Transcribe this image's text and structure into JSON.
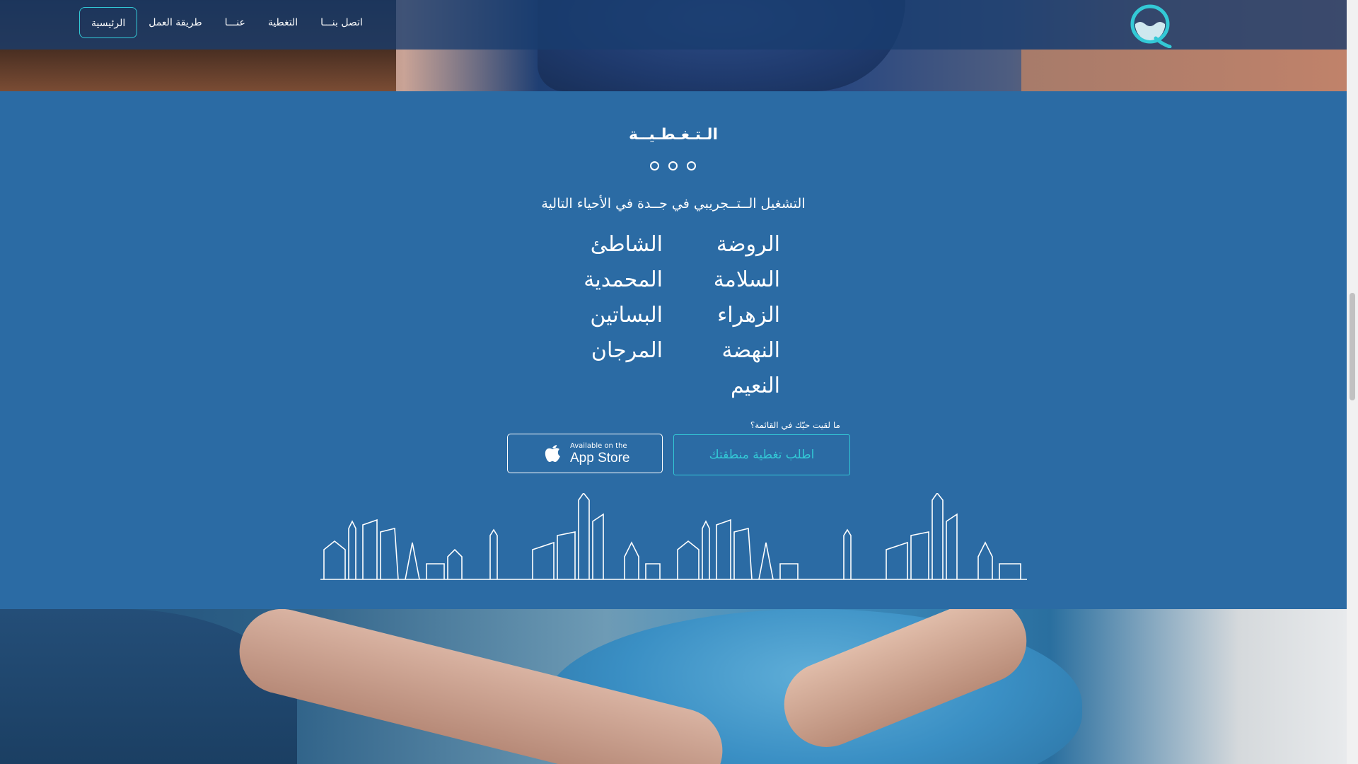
{
  "nav": {
    "items": [
      {
        "label": "الرئيسية",
        "active": true
      },
      {
        "label": "طريقة العمل",
        "active": false
      },
      {
        "label": "عنـــا",
        "active": false
      },
      {
        "label": "التغطية",
        "active": false
      },
      {
        "label": "اتصل بنـــا",
        "active": false
      }
    ],
    "logo_icon": "q-water-logo-icon"
  },
  "coverage": {
    "title": "الـتـغـطـيــة",
    "subtitle": "التشغيل الــتــجريبي في جــدة في الأحياء التالية",
    "districts_right": [
      "الروضة",
      "السلامة",
      "الزهراء",
      "النهضة",
      "النعيم"
    ],
    "districts_left": [
      "الشاطئ",
      "المحمدية",
      "البساتين",
      "المرجان"
    ],
    "question": "ما لقيت حيّك في القائمة؟",
    "request_button": "اطلب تغطية منطقتك",
    "appstore": {
      "small": "Available on the",
      "big": "App Store"
    }
  },
  "colors": {
    "section_bg": "#2b6ba4",
    "accent": "#33c9d6",
    "nav_bg": "#183c6e"
  }
}
